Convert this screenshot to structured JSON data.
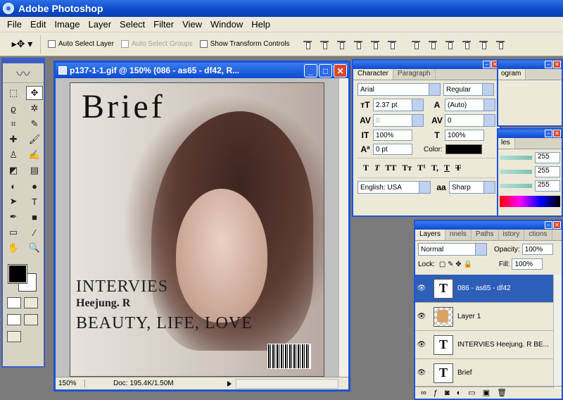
{
  "app": {
    "title": "Adobe Photoshop"
  },
  "menu": [
    "File",
    "Edit",
    "Image",
    "Layer",
    "Select",
    "Filter",
    "View",
    "Window",
    "Help"
  ],
  "options": {
    "auto_select_layer": "Auto Select Layer",
    "auto_select_groups": "Auto Select Groups",
    "show_transform_controls": "Show Transform Controls"
  },
  "document": {
    "title": "p137-1-1.gif @ 150% (086 -   as65 - df42, R...",
    "zoom": "150%",
    "doc_size": "Doc: 195.4K/1.50M",
    "image_text": {
      "brief": "Brief",
      "intervies": "INTERVIES",
      "heejung": "Heejung. R",
      "beauty": "BEAUTY, LIFE, LOVE"
    }
  },
  "character": {
    "tabs": [
      "Character",
      "Paragraph"
    ],
    "font_family": "Arial",
    "font_style": "Regular",
    "size": "2.37 pt",
    "leading": "(Auto)",
    "kerning": "0",
    "tracking": "0",
    "vscale": "100%",
    "hscale": "100%",
    "baseline": "0 pt",
    "color_label": "Color:",
    "language": "English: USA",
    "antialias": "Sharp",
    "aa_icon": "aa"
  },
  "histogram": {
    "tab": "ogram"
  },
  "colors": {
    "tab": "les",
    "values": [
      "255",
      "255",
      "255"
    ]
  },
  "layers": {
    "tabs": [
      "Layers",
      "nnels",
      "Paths",
      "istory",
      "ctions"
    ],
    "blend_mode": "Normal",
    "opacity_label": "Opacity:",
    "opacity": "100%",
    "lock_label": "Lock:",
    "fill_label": "Fill:",
    "fill": "100%",
    "items": [
      {
        "name": "086 -  as65 - df42",
        "thumb": "T"
      },
      {
        "name": "Layer 1",
        "thumb": ""
      },
      {
        "name": "INTERVIES Heejung. R BE...",
        "thumb": "T"
      },
      {
        "name": "Brief",
        "thumb": "T"
      }
    ]
  }
}
